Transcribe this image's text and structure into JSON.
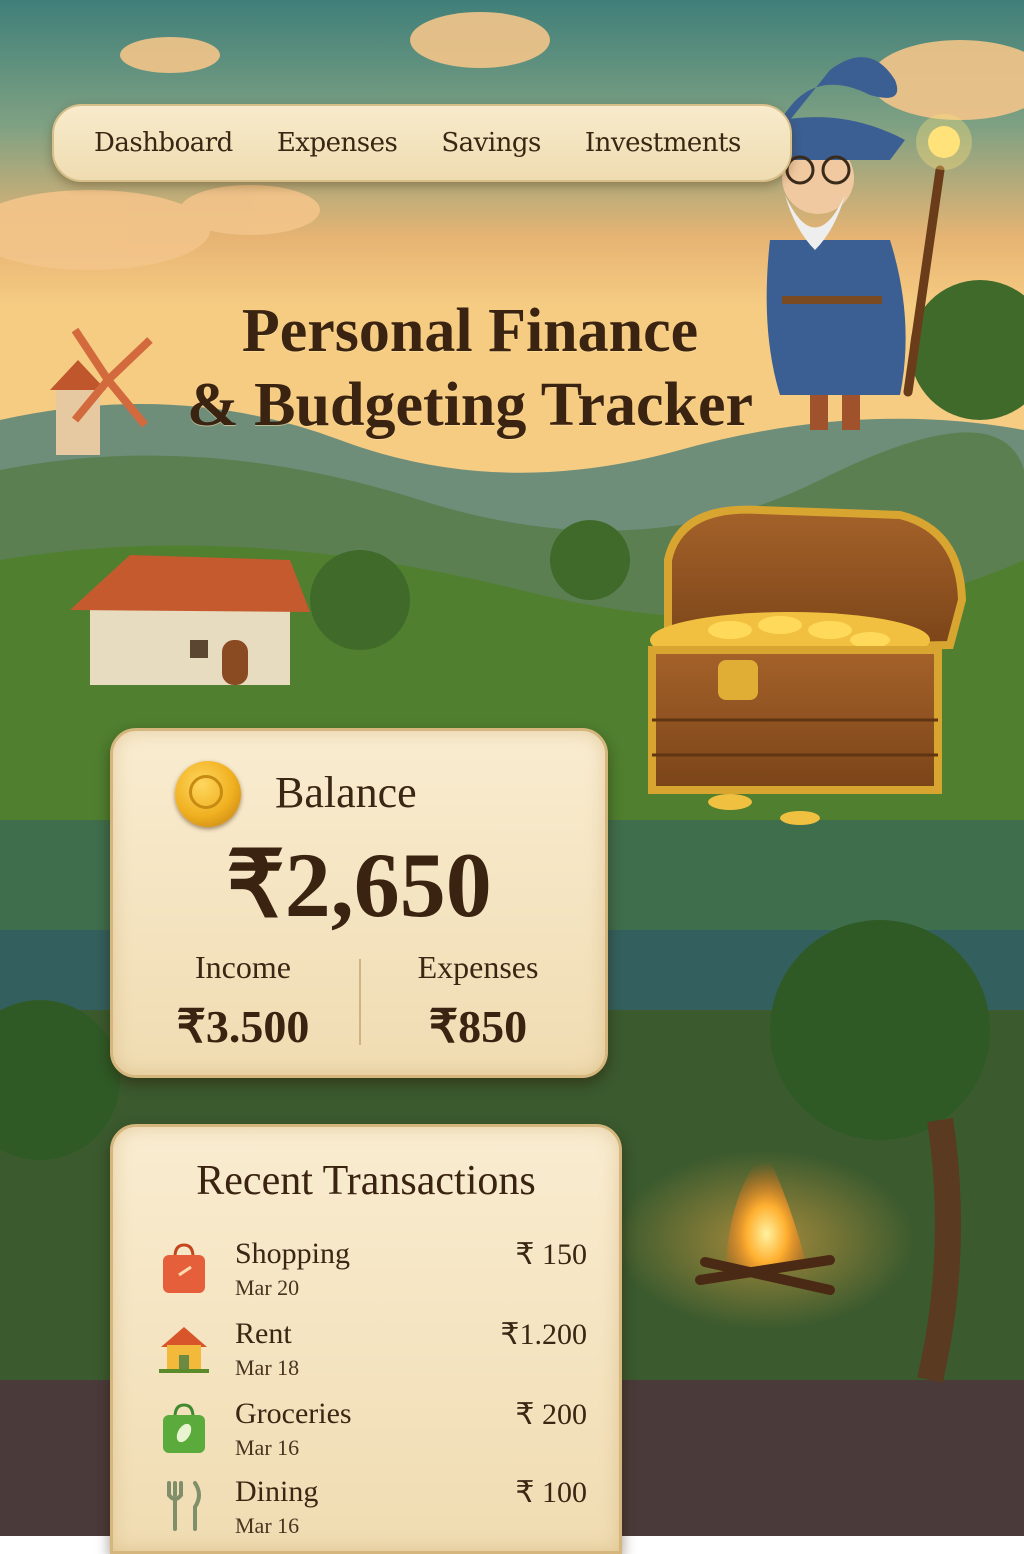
{
  "nav": {
    "items": [
      {
        "label": "Dashboard"
      },
      {
        "label": "Expenses"
      },
      {
        "label": "Savings"
      },
      {
        "label": "Investments"
      }
    ]
  },
  "header": {
    "title_line1": "Personal Finance",
    "title_line2": "& Budgeting Tracker"
  },
  "balance": {
    "label": "Balance",
    "amount": "₹2,650",
    "income_label": "Income",
    "income_value": "₹3.500",
    "expenses_label": "Expenses",
    "expenses_value": "₹850"
  },
  "transactions": {
    "title": "Recent Transactions",
    "items": [
      {
        "name": "Shopping",
        "date": "Mar 20",
        "amount": "₹ 150",
        "icon": "shopping-bag-icon"
      },
      {
        "name": "Rent",
        "date": "Mar 18",
        "amount": "₹1.200",
        "icon": "house-icon"
      },
      {
        "name": "Groceries",
        "date": "Mar 16",
        "amount": "₹ 200",
        "icon": "grocery-bag-icon"
      },
      {
        "name": "Dining",
        "date": "Mar 16",
        "amount": "₹ 100",
        "icon": "fork-knife-icon"
      }
    ]
  },
  "colors": {
    "parchment": "#f5e4c0",
    "ink": "#3b2614",
    "gold": "#e9a520",
    "sky_top": "#3f7f79",
    "sky_glow": "#f4c27a",
    "meadow": "#4f7f2f"
  }
}
